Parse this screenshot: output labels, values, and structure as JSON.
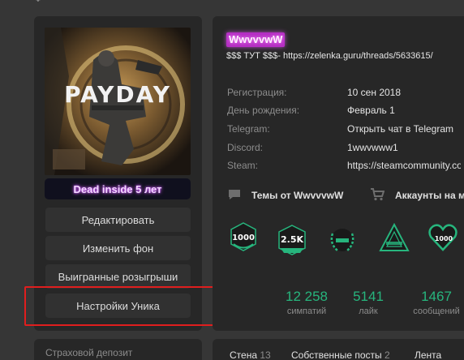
{
  "top_stub": "Ф",
  "profile": {
    "avatar_banner": "Dead inside 5 лет",
    "menu": [
      "Редактировать",
      "Изменить фон",
      "Выигранные розыгрыши",
      "Настройки Уника"
    ]
  },
  "user": {
    "name": "WwvvvwW",
    "status": "$$$ ТУТ $$$- https://zelenka.guru/threads/5633615/",
    "info": [
      {
        "label": "Регистрация:",
        "value": "10 сен 2018"
      },
      {
        "label": "День рождения:",
        "value": "Февраль 1"
      },
      {
        "label": "Telegram:",
        "value": "Открыть чат в Telegram"
      },
      {
        "label": "Discord:",
        "value": "1wwvwww1"
      },
      {
        "label": "Steam:",
        "value": "https://steamcommunity.com"
      }
    ],
    "links": {
      "threads": "Темы от WwvvvwW",
      "accounts": "Аккаунты на ма"
    },
    "achievements": [
      {
        "icon": "achievement-1000-icon",
        "text": "1000"
      },
      {
        "icon": "achievement-2-5k-icon",
        "text": "2.5K"
      },
      {
        "icon": "achievement-wreath-icon"
      },
      {
        "icon": "achievement-triangle-icon"
      },
      {
        "icon": "achievement-heart-1000-icon",
        "text": "1000"
      }
    ],
    "stats": [
      {
        "value": "12 258",
        "label": "симпатий"
      },
      {
        "value": "5141",
        "label": "лайк"
      },
      {
        "value": "1467",
        "label": "сообщений"
      }
    ]
  },
  "bottom": {
    "left_text": "Страховой депозит",
    "tabs": [
      {
        "label": "Стена",
        "count": "13"
      },
      {
        "label": "Собственные посты",
        "count": "2"
      },
      {
        "label": "Лента"
      }
    ]
  },
  "colors": {
    "accent_green": "#27b57d",
    "highlight_red": "#e01e1e",
    "username_bg": "#b52ec4"
  }
}
